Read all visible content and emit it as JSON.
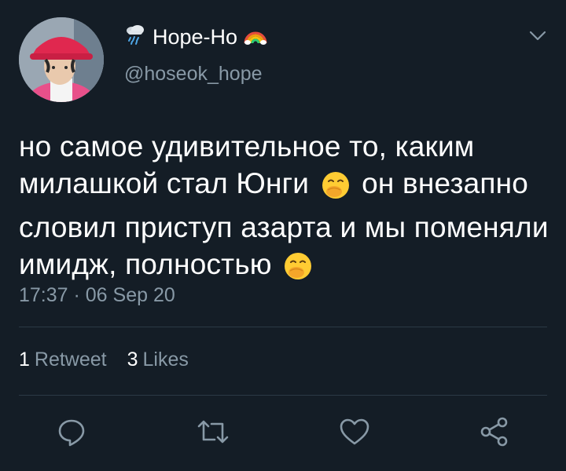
{
  "author": {
    "display_name": "Hope-Ho",
    "handle": "@hoseok_hope",
    "name_prefix_icon": "cloud-rain-icon",
    "name_suffix_icon": "rainbow-icon",
    "avatar": "user-avatar-photo"
  },
  "tweet": {
    "text_line1": "но самое удивительное то, каким",
    "text_line2a": "милашкой стал Юнги",
    "text_line2b": "он внезапно",
    "text_line3": "словил приступ азарта и мы поменяли",
    "text_line4": "имидж, полностью",
    "emoji": "face-with-hand-over-mouth-emoji",
    "timestamp": "17:37 · 06 Sep 20"
  },
  "stats": {
    "retweets_count": "1",
    "retweets_label": "Retweet",
    "likes_count": "3",
    "likes_label": "Likes"
  },
  "actions": [
    "reply-icon",
    "retweet-icon",
    "like-icon",
    "share-icon"
  ],
  "colors": {
    "background": "#141d26",
    "text_primary": "#ffffff",
    "text_secondary": "#8899a6",
    "divider": "#2b3945"
  }
}
